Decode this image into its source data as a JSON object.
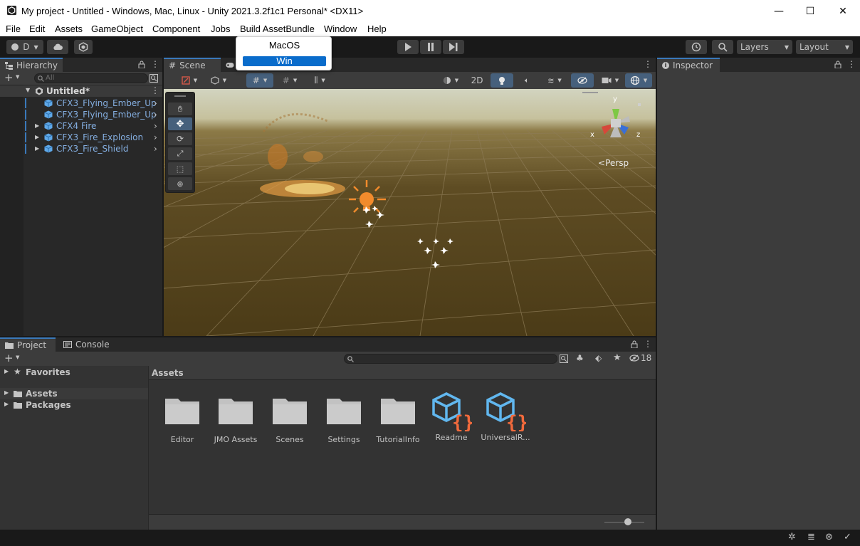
{
  "window": {
    "title": "My project - Untitled - Windows, Mac, Linux - Unity 2021.3.2f1c1 Personal* <DX11>",
    "minimize_glyph": "—",
    "maximize_glyph": "☐",
    "close_glyph": "✕"
  },
  "menu": [
    "File",
    "Edit",
    "Assets",
    "GameObject",
    "Component",
    "Jobs",
    "Build AssetBundle",
    "Window",
    "Help"
  ],
  "build_dropdown": {
    "items": [
      "MacOS",
      "Win"
    ],
    "selected": "Win"
  },
  "toolbar": {
    "account_label": "D",
    "layers_label": "Layers",
    "layout_label": "Layout"
  },
  "hierarchy": {
    "tab_label": "Hierarchy",
    "search_placeholder": "All",
    "scene_name": "Untitled*",
    "items": [
      {
        "label": "CFX3_Flying_Ember_Up",
        "expandable": false
      },
      {
        "label": "CFX3_Flying_Ember_Up",
        "expandable": false
      },
      {
        "label": "CFX4 Fire",
        "expandable": true
      },
      {
        "label": "CFX3_Fire_Explosion",
        "expandable": true
      },
      {
        "label": "CFX3_Fire_Shield",
        "expandable": true
      }
    ]
  },
  "scene": {
    "tab_label": "Scene",
    "mode_2d_label": "2D",
    "persp_label": "Persp",
    "gizmo_axes": {
      "x": "x",
      "y": "y",
      "z": "z"
    }
  },
  "inspector": {
    "tab_label": "Inspector"
  },
  "project": {
    "tab_label": "Project",
    "console_tab_label": "Console",
    "hidden_count": "18",
    "tree": [
      {
        "label": "Favorites",
        "icon": "star-icon"
      },
      {
        "label": "Assets",
        "icon": "folder-icon",
        "selected": true
      },
      {
        "label": "Packages",
        "icon": "folder-icon"
      }
    ],
    "breadcrumb": "Assets",
    "assets": [
      {
        "label": "Editor",
        "kind": "folder"
      },
      {
        "label": "JMO Assets",
        "kind": "folder"
      },
      {
        "label": "Scenes",
        "kind": "folder"
      },
      {
        "label": "Settings",
        "kind": "folder"
      },
      {
        "label": "TutorialInfo",
        "kind": "folder"
      },
      {
        "label": "Readme",
        "kind": "script-asset"
      },
      {
        "label": "UniversalR...",
        "kind": "script-asset"
      }
    ]
  },
  "colors": {
    "accent": "#3a79bb",
    "selection": "#0a6ccb",
    "prefab_text": "#84aee0",
    "asset_icon_blue": "#61b7ef",
    "asset_icon_orange": "#f26a3c",
    "light_orange": "#f28b2c"
  }
}
